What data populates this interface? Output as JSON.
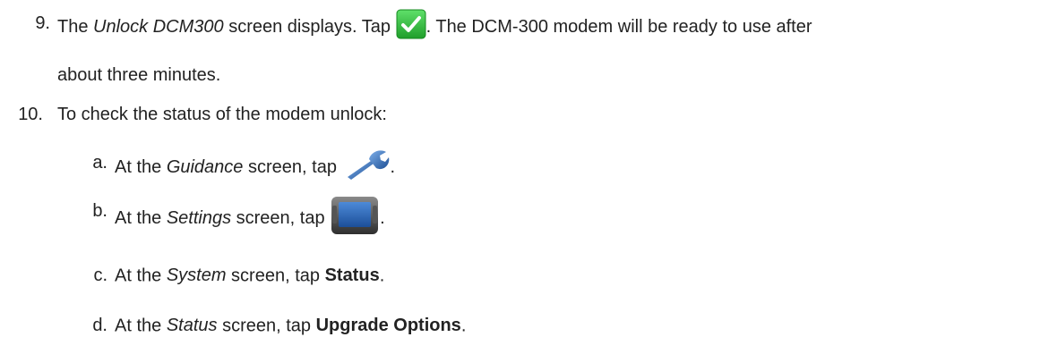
{
  "steps": {
    "s9": {
      "num": "9.",
      "t1": "The ",
      "t2": "Unlock DCM300",
      "t3": " screen displays. Tap ",
      "icon": "green-checkmark-button",
      "t4": ". The DCM-300 modem will be ready to use after",
      "line2": "about three minutes."
    },
    "s10": {
      "num": "10.",
      "text": "To check the status of the modem unlock:"
    }
  },
  "substeps": {
    "a": {
      "num": "a.",
      "t1": "At the ",
      "t2": "Guidance",
      "t3": " screen, tap ",
      "icon": "wrench-icon",
      "t4": "."
    },
    "b": {
      "num": "b.",
      "t1": "At the ",
      "t2": "Settings",
      "t3": " screen, tap ",
      "icon": "display-device-icon",
      "t4": "."
    },
    "c": {
      "num": "c.",
      "t1": "At the ",
      "t2": "System",
      "t3": " screen, tap ",
      "bold": "Status",
      "t4": "."
    },
    "d": {
      "num": "d.",
      "t1": "At the ",
      "t2": "Status",
      "t3": " screen, tap ",
      "bold": "Upgrade Options",
      "t4": "."
    }
  },
  "colors": {
    "text": "#222222",
    "check_green": "#2fbf3a",
    "wrench_blue": "#2f6fb5",
    "device_gray": "#4a4a4a",
    "screen_blue": "#2a66b8"
  }
}
